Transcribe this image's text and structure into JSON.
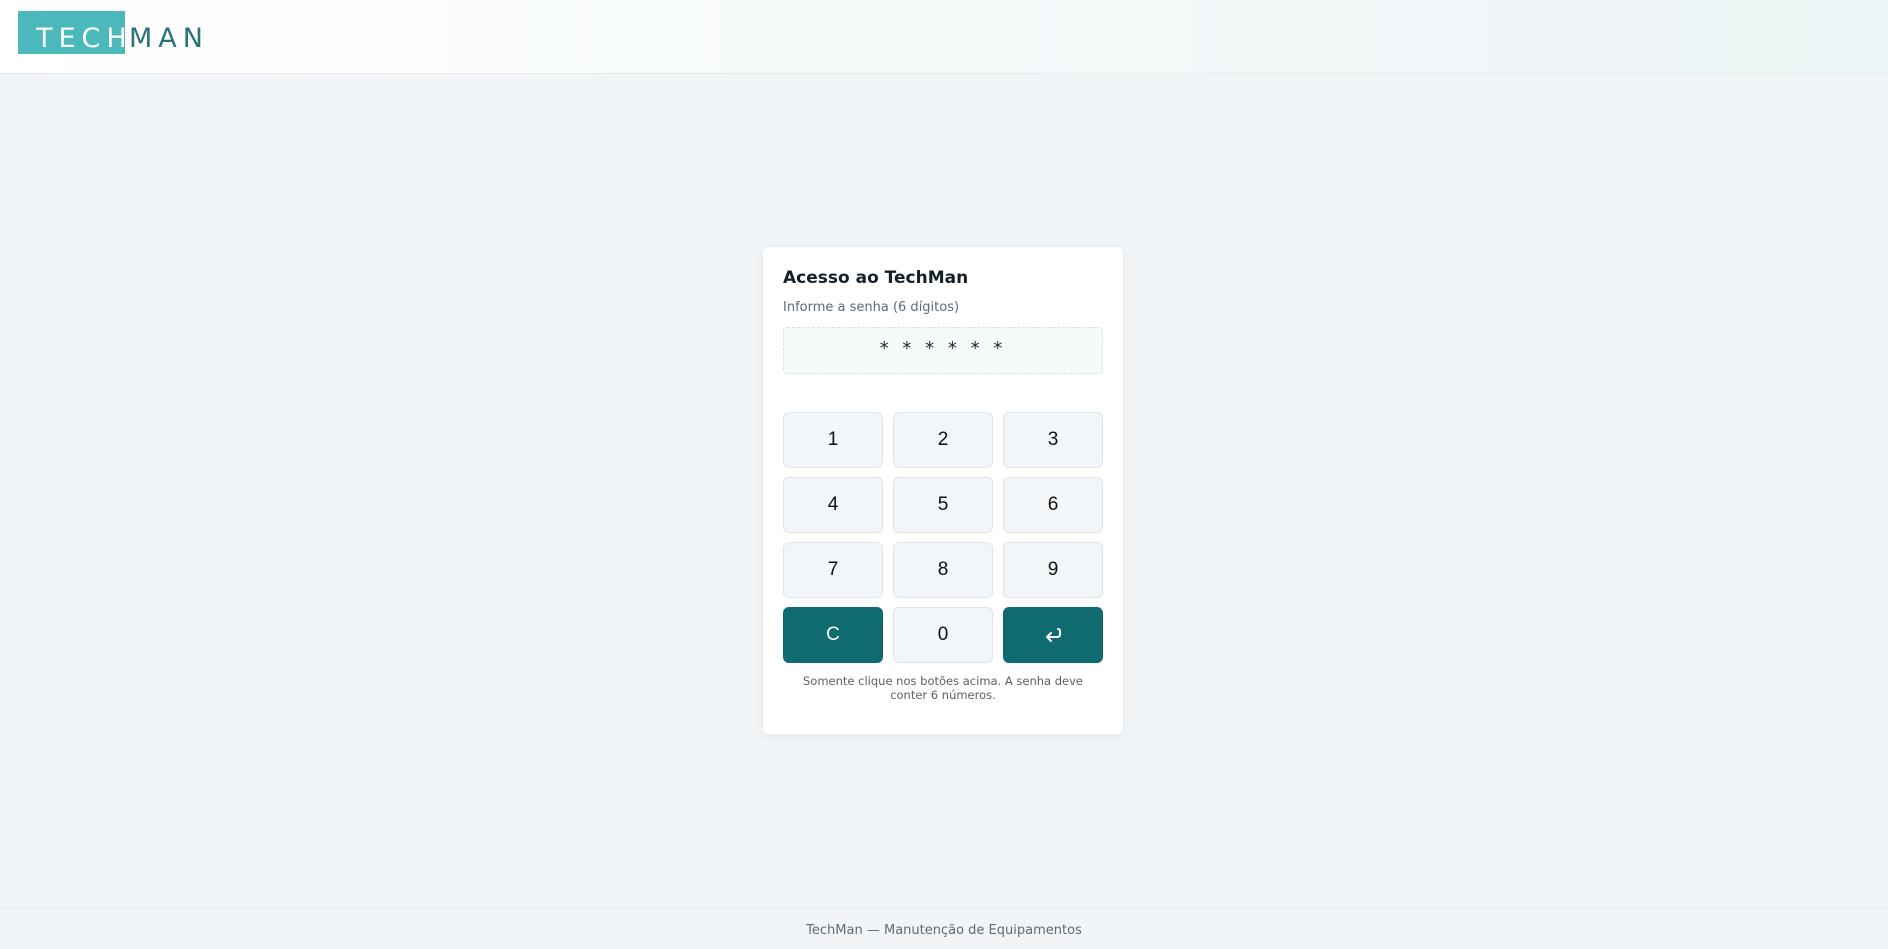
{
  "header": {
    "logo_part1": "TECH",
    "logo_part2": "MAN",
    "logo_block_color": "#4bb8bb",
    "logo_text_color": "#2c7279"
  },
  "login": {
    "title": "Acesso ao TechMan",
    "subtitle": "Informe a senha (6 dígitos)",
    "pin_display": "* * * * * *",
    "keys": {
      "k1": "1",
      "k2": "2",
      "k3": "3",
      "k4": "4",
      "k5": "5",
      "k6": "6",
      "k7": "7",
      "k8": "8",
      "k9": "9",
      "clear": "C",
      "k0": "0",
      "enter_icon": "enter-arrow-icon"
    },
    "hint": "Somente clique nos botões acima. A senha deve conter 6 números.",
    "accent_color": "#0f6b6f"
  },
  "footer": {
    "text": "TechMan — Manutenção de Equipamentos"
  }
}
